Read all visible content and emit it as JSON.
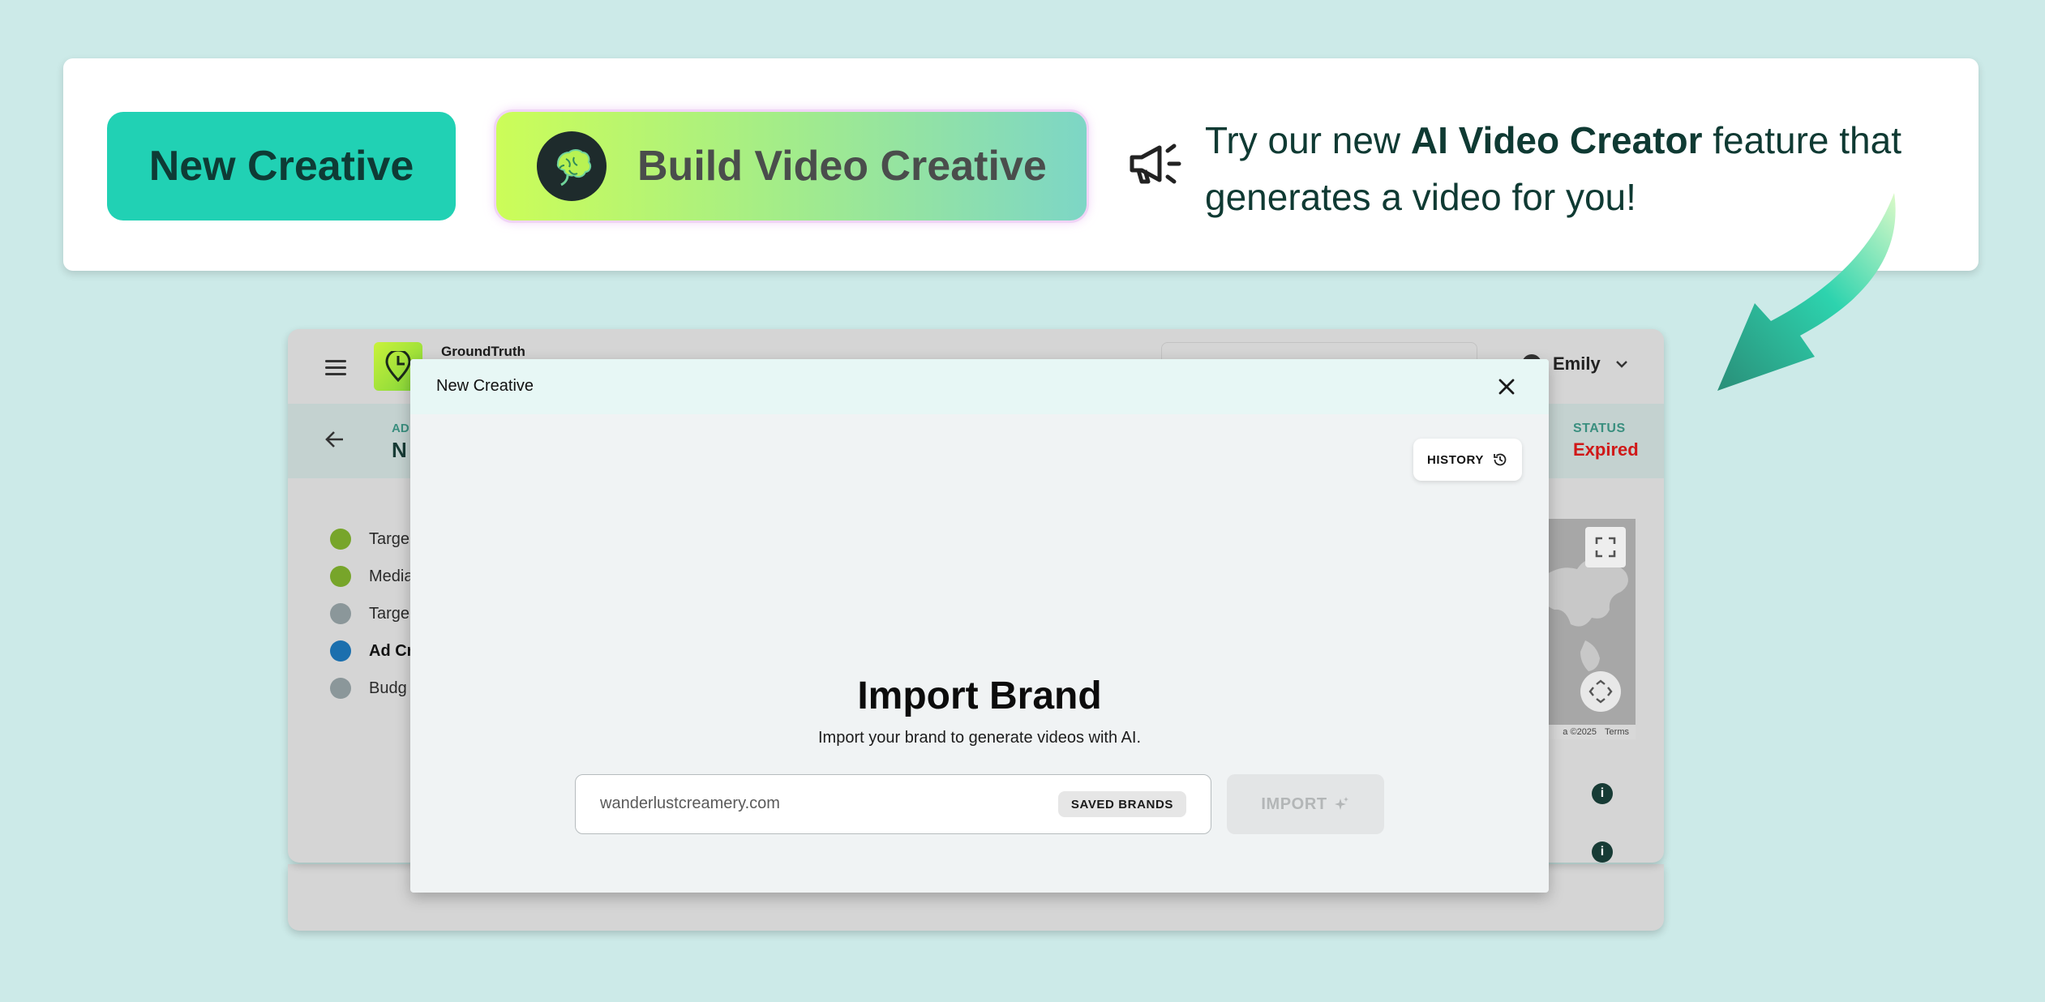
{
  "promo": {
    "new_creative_label": "New Creative",
    "build_video_label": "Build Video Creative",
    "text_prefix": "Try our new ",
    "text_bold": "AI Video Creator",
    "text_suffix": " feature that generates a video for you!"
  },
  "app": {
    "brand_name": "GroundTruth",
    "user_name": "Emily",
    "subheader": {
      "small_label": "AD",
      "big_label": "N"
    },
    "status": {
      "label": "STATUS",
      "value": "Expired"
    },
    "steps": [
      {
        "label": "Targe",
        "color": "#77a52a"
      },
      {
        "label": "Media",
        "color": "#77a52a"
      },
      {
        "label": "Targe",
        "color": "#8b979a"
      },
      {
        "label": "Ad Cr",
        "color": "#1b6fae"
      },
      {
        "label": "Budg",
        "color": "#8b979a"
      }
    ],
    "map": {
      "copyright": "a ©2025",
      "terms": "Terms"
    }
  },
  "modal": {
    "title": "New Creative",
    "history_label": "HISTORY",
    "heading": "Import Brand",
    "subheading": "Import your brand to generate videos with AI.",
    "url_value": "wanderlustcreamery.com",
    "saved_brands_label": "SAVED BRANDS",
    "import_label": "IMPORT"
  },
  "colors": {
    "page_bg": "#cceae8",
    "new_creative_bg": "#21d1b4",
    "status_expired": "#d01818",
    "modal_header_bg": "#e7f7f5"
  }
}
